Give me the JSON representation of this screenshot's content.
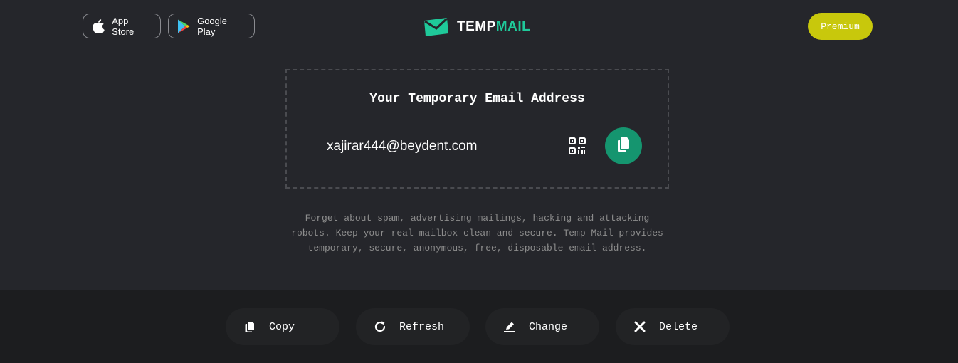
{
  "header": {
    "app_store_label": "App Store",
    "google_play_label": "Google Play",
    "logo_word_1": "TEMP",
    "logo_word_2": "MAIL",
    "premium_label": "Premium"
  },
  "email_card": {
    "title": "Your Temporary Email Address",
    "email": "xajirar444@beydent.com"
  },
  "description": "Forget about spam, advertising mailings, hacking and attacking robots. Keep your real mailbox clean and secure. Temp Mail provides temporary, secure, anonymous, free, disposable email address.",
  "actions": {
    "copy_label": "Copy",
    "refresh_label": "Refresh",
    "change_label": "Change",
    "delete_label": "Delete"
  },
  "colors": {
    "accent_green": "#15956f",
    "logo_green": "#1fc99a",
    "premium_yellow": "#c8c80c",
    "background": "#25262b",
    "bar_background": "#1c1d1f"
  },
  "icons": [
    "apple-icon",
    "google-play-icon",
    "envelope-logo-icon",
    "qr-code-icon",
    "copy-icon",
    "refresh-icon",
    "edit-icon",
    "close-icon"
  ]
}
